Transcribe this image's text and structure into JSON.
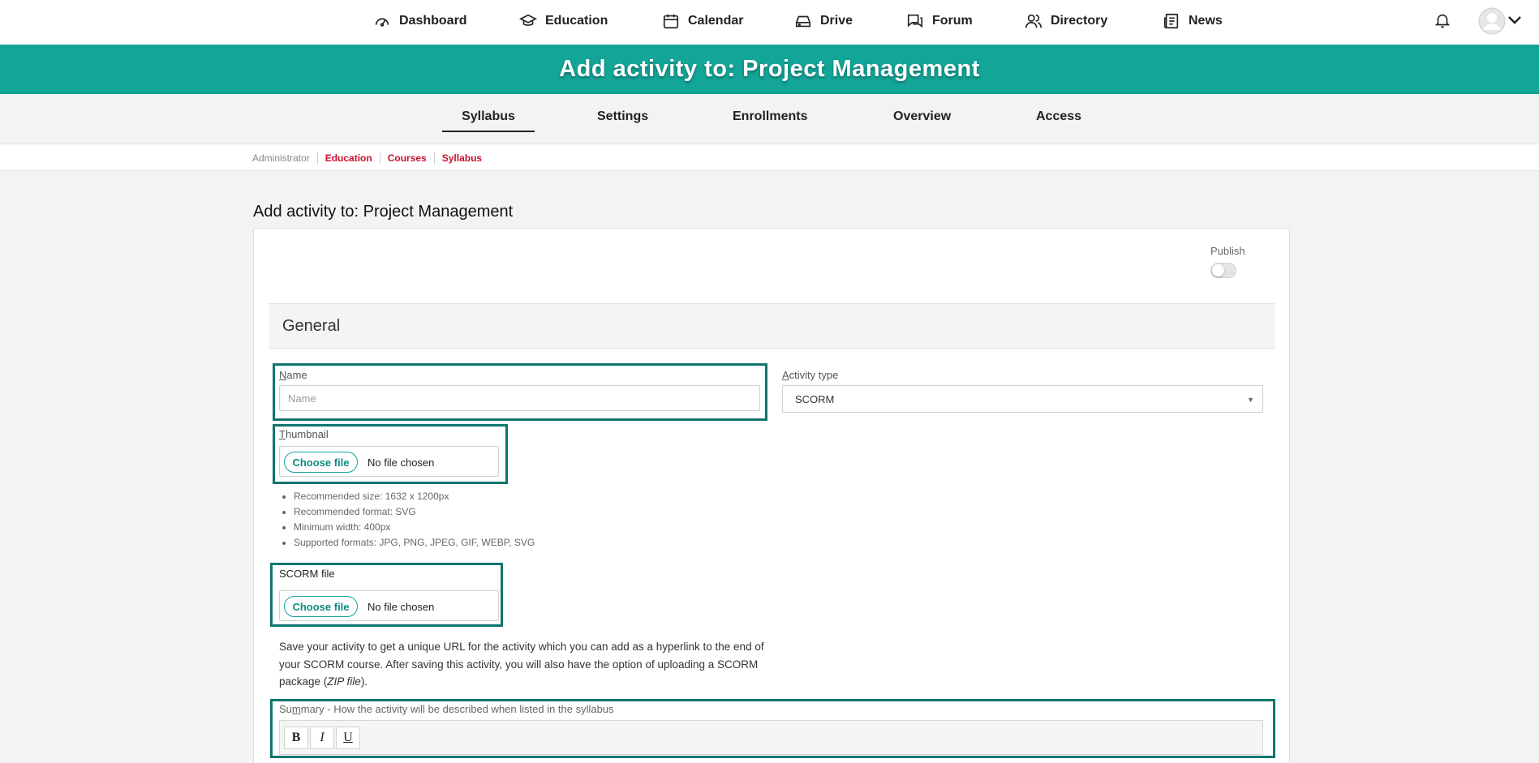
{
  "topnav": {
    "items": [
      {
        "label": "Dashboard",
        "icon": "dashboard-gauge-icon"
      },
      {
        "label": "Education",
        "icon": "graduation-cap-icon"
      },
      {
        "label": "Calendar",
        "icon": "calendar-icon"
      },
      {
        "label": "Drive",
        "icon": "drive-icon"
      },
      {
        "label": "Forum",
        "icon": "forum-chat-icon"
      },
      {
        "label": "Directory",
        "icon": "people-icon"
      },
      {
        "label": "News",
        "icon": "newspaper-icon"
      }
    ],
    "notification_icon": "bell-icon",
    "avatar_icon": "user-avatar-icon"
  },
  "banner": {
    "title": "Add activity to: Project Management"
  },
  "tabs": [
    {
      "label": "Syllabus",
      "active": true
    },
    {
      "label": "Settings",
      "active": false
    },
    {
      "label": "Enrollments",
      "active": false
    },
    {
      "label": "Overview",
      "active": false
    },
    {
      "label": "Access",
      "active": false
    }
  ],
  "breadcrumb": [
    "Administrator",
    "Education",
    "Courses",
    "Syllabus"
  ],
  "page_title": "Add activity to: Project Management",
  "publish": {
    "label": "Publish",
    "on": false
  },
  "section": {
    "title": "General"
  },
  "form": {
    "name": {
      "label_first": "N",
      "label_rest": "ame",
      "placeholder": "Name",
      "value": ""
    },
    "activity_type": {
      "label_first": "A",
      "label_rest": "ctivity type",
      "value": "SCORM"
    },
    "thumbnail": {
      "label_first": "T",
      "label_rest": "humbnail",
      "button": "Choose file",
      "status": "No file chosen",
      "hints": [
        "Recommended size: 1632 x 1200px",
        "Recommended format: SVG",
        "Minimum width: 400px",
        "Supported formats: JPG, PNG, JPEG, GIF, WEBP, SVG"
      ]
    },
    "scorm": {
      "label": "SCORM file",
      "button": "Choose file",
      "status": "No file chosen"
    },
    "help": {
      "before": "Save your activity to get a unique URL for the activity which you can add as a hyperlink to the end of your SCORM course. After saving this activity, you will also have the option of uploading a SCORM package (",
      "em": "ZIP file",
      "after": ")."
    },
    "summary": {
      "label_a": "Su",
      "label_u": "m",
      "label_b": "mary - How the activity will be described when listed in the syllabus",
      "toolbar": {
        "bold": "B",
        "italic": "I",
        "underline": "U"
      }
    }
  },
  "colors": {
    "accent": "#13a598",
    "highlight": "#0f766e",
    "link": "#c8102e"
  }
}
